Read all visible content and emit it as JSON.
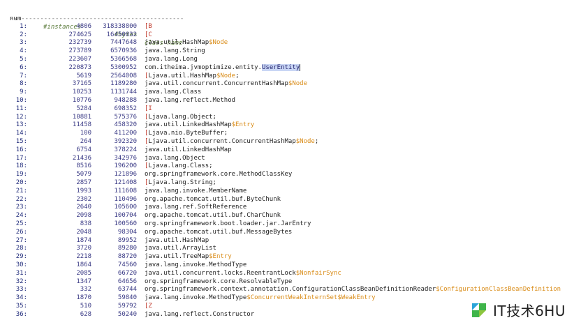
{
  "header": {
    "num": "num",
    "instances": "#instances",
    "bytes": "#bytes",
    "class_name": "class name"
  },
  "separator": "----------------------------------------------",
  "rows": [
    {
      "num": "1:",
      "instances": "4806",
      "bytes": "318338800",
      "parts": [
        {
          "t": "[B",
          "c": "br"
        }
      ]
    },
    {
      "num": "2:",
      "instances": "274625",
      "bytes": "16450832",
      "parts": [
        {
          "t": "[C",
          "c": "br"
        }
      ]
    },
    {
      "num": "3:",
      "instances": "232739",
      "bytes": "7447648",
      "parts": [
        {
          "t": "java.util.HashMap",
          "c": "cls"
        },
        {
          "t": "$Node",
          "c": "or"
        }
      ]
    },
    {
      "num": "4:",
      "instances": "273789",
      "bytes": "6570936",
      "parts": [
        {
          "t": "java.lang.String",
          "c": "cls"
        }
      ]
    },
    {
      "num": "5:",
      "instances": "223607",
      "bytes": "5366568",
      "parts": [
        {
          "t": "java.lang.Long",
          "c": "cls"
        }
      ]
    },
    {
      "num": "6:",
      "instances": "220873",
      "bytes": "5300952",
      "parts": [
        {
          "t": "com.itheima.jvmoptimize.entity.",
          "c": "cls"
        },
        {
          "t": "UserEntity",
          "c": "hl"
        }
      ]
    },
    {
      "num": "7:",
      "instances": "5619",
      "bytes": "2564008",
      "parts": [
        {
          "t": "[",
          "c": "br"
        },
        {
          "t": "Ljava.util.HashMap",
          "c": "cls"
        },
        {
          "t": "$Node",
          "c": "or"
        },
        {
          "t": ";",
          "c": "cls"
        }
      ]
    },
    {
      "num": "8:",
      "instances": "37165",
      "bytes": "1189280",
      "parts": [
        {
          "t": "java.util.concurrent.ConcurrentHashMap",
          "c": "cls"
        },
        {
          "t": "$Node",
          "c": "or"
        }
      ]
    },
    {
      "num": "9:",
      "instances": "10253",
      "bytes": "1131744",
      "parts": [
        {
          "t": "java.lang.Class",
          "c": "cls"
        }
      ]
    },
    {
      "num": "10:",
      "instances": "10776",
      "bytes": "948288",
      "parts": [
        {
          "t": "java.lang.reflect.Method",
          "c": "cls"
        }
      ]
    },
    {
      "num": "11:",
      "instances": "5284",
      "bytes": "698352",
      "parts": [
        {
          "t": "[I",
          "c": "br"
        }
      ]
    },
    {
      "num": "12:",
      "instances": "10881",
      "bytes": "575376",
      "parts": [
        {
          "t": "[",
          "c": "br"
        },
        {
          "t": "Ljava.lang.Object;",
          "c": "cls"
        }
      ]
    },
    {
      "num": "13:",
      "instances": "11458",
      "bytes": "458320",
      "parts": [
        {
          "t": "java.util.LinkedHashMap",
          "c": "cls"
        },
        {
          "t": "$Entry",
          "c": "or"
        }
      ]
    },
    {
      "num": "14:",
      "instances": "100",
      "bytes": "411200",
      "parts": [
        {
          "t": "[",
          "c": "br"
        },
        {
          "t": "Ljava.nio.ByteBuffer;",
          "c": "cls"
        }
      ]
    },
    {
      "num": "15:",
      "instances": "264",
      "bytes": "392320",
      "parts": [
        {
          "t": "[",
          "c": "br"
        },
        {
          "t": "Ljava.util.concurrent.ConcurrentHashMap",
          "c": "cls"
        },
        {
          "t": "$Node",
          "c": "or"
        },
        {
          "t": ";",
          "c": "cls"
        }
      ]
    },
    {
      "num": "16:",
      "instances": "6754",
      "bytes": "378224",
      "parts": [
        {
          "t": "java.util.LinkedHashMap",
          "c": "cls"
        }
      ]
    },
    {
      "num": "17:",
      "instances": "21436",
      "bytes": "342976",
      "parts": [
        {
          "t": "java.lang.Object",
          "c": "cls"
        }
      ]
    },
    {
      "num": "18:",
      "instances": "8516",
      "bytes": "196200",
      "parts": [
        {
          "t": "[",
          "c": "br"
        },
        {
          "t": "Ljava.lang.Class;",
          "c": "cls"
        }
      ]
    },
    {
      "num": "19:",
      "instances": "5079",
      "bytes": "121896",
      "parts": [
        {
          "t": "org.springframework.core.MethodClassKey",
          "c": "cls"
        }
      ]
    },
    {
      "num": "20:",
      "instances": "2857",
      "bytes": "121408",
      "parts": [
        {
          "t": "[",
          "c": "br"
        },
        {
          "t": "Ljava.lang.String;",
          "c": "cls"
        }
      ]
    },
    {
      "num": "21:",
      "instances": "1993",
      "bytes": "111608",
      "parts": [
        {
          "t": "java.lang.invoke.MemberName",
          "c": "cls"
        }
      ]
    },
    {
      "num": "22:",
      "instances": "2302",
      "bytes": "110496",
      "parts": [
        {
          "t": "org.apache.tomcat.util.buf.ByteChunk",
          "c": "cls"
        }
      ]
    },
    {
      "num": "23:",
      "instances": "2640",
      "bytes": "105600",
      "parts": [
        {
          "t": "java.lang.ref.SoftReference",
          "c": "cls"
        }
      ]
    },
    {
      "num": "24:",
      "instances": "2098",
      "bytes": "100704",
      "parts": [
        {
          "t": "org.apache.tomcat.util.buf.CharChunk",
          "c": "cls"
        }
      ]
    },
    {
      "num": "25:",
      "instances": "838",
      "bytes": "100560",
      "parts": [
        {
          "t": "org.springframework.boot.loader.jar.JarEntry",
          "c": "cls"
        }
      ]
    },
    {
      "num": "26:",
      "instances": "2048",
      "bytes": "98304",
      "parts": [
        {
          "t": "org.apache.tomcat.util.buf.MessageBytes",
          "c": "cls"
        }
      ]
    },
    {
      "num": "27:",
      "instances": "1874",
      "bytes": "89952",
      "parts": [
        {
          "t": "java.util.HashMap",
          "c": "cls"
        }
      ]
    },
    {
      "num": "28:",
      "instances": "3720",
      "bytes": "89280",
      "parts": [
        {
          "t": "java.util.ArrayList",
          "c": "cls"
        }
      ]
    },
    {
      "num": "29:",
      "instances": "2218",
      "bytes": "88720",
      "parts": [
        {
          "t": "java.util.TreeMap",
          "c": "cls"
        },
        {
          "t": "$Entry",
          "c": "or"
        }
      ]
    },
    {
      "num": "30:",
      "instances": "1864",
      "bytes": "74560",
      "parts": [
        {
          "t": "java.lang.invoke.MethodType",
          "c": "cls"
        }
      ]
    },
    {
      "num": "31:",
      "instances": "2085",
      "bytes": "66720",
      "parts": [
        {
          "t": "java.util.concurrent.locks.ReentrantLock",
          "c": "cls"
        },
        {
          "t": "$NonfairSync",
          "c": "or"
        }
      ]
    },
    {
      "num": "32:",
      "instances": "1347",
      "bytes": "64656",
      "parts": [
        {
          "t": "org.springframework.core.ResolvableType",
          "c": "cls"
        }
      ]
    },
    {
      "num": "33:",
      "instances": "332",
      "bytes": "63744",
      "parts": [
        {
          "t": "org.springframework.context.annotation.ConfigurationClassBeanDefinitionReader",
          "c": "cls"
        },
        {
          "t": "$ConfigurationClassBeanDefinition",
          "c": "or"
        }
      ]
    },
    {
      "num": "34:",
      "instances": "1870",
      "bytes": "59840",
      "parts": [
        {
          "t": "java.lang.invoke.MethodType",
          "c": "cls"
        },
        {
          "t": "$ConcurrentWeakInternSet$WeakEntry",
          "c": "or"
        }
      ]
    },
    {
      "num": "35:",
      "instances": "510",
      "bytes": "59792",
      "parts": [
        {
          "t": "[Z",
          "c": "br"
        }
      ]
    },
    {
      "num": "36:",
      "instances": "628",
      "bytes": "50240",
      "parts": [
        {
          "t": "java.lang.reflect.Constructor",
          "c": "cls"
        }
      ]
    }
  ],
  "watermark": {
    "text": "IT技术6HU",
    "logo_colors": [
      "#2aa4d8",
      "#3fb54a",
      "#8cc63f"
    ]
  }
}
